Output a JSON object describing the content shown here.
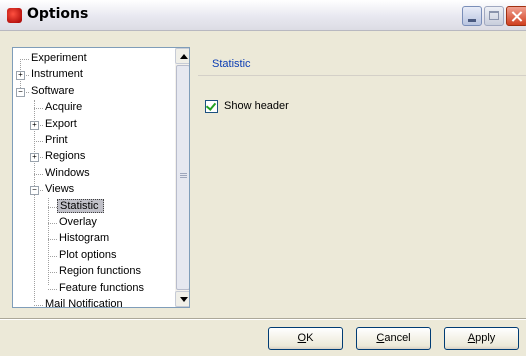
{
  "window": {
    "title": "Options"
  },
  "tree": {
    "items": [
      {
        "label": "Experiment",
        "level": 0,
        "expander": "none"
      },
      {
        "label": "Instrument",
        "level": 0,
        "expander": "+"
      },
      {
        "label": "Software",
        "level": 0,
        "expander": "-"
      },
      {
        "label": "Acquire",
        "level": 1,
        "expander": "none"
      },
      {
        "label": "Export",
        "level": 1,
        "expander": "+"
      },
      {
        "label": "Print",
        "level": 1,
        "expander": "none"
      },
      {
        "label": "Regions",
        "level": 1,
        "expander": "+"
      },
      {
        "label": "Windows",
        "level": 1,
        "expander": "none"
      },
      {
        "label": "Views",
        "level": 1,
        "expander": "-"
      },
      {
        "label": "Statistic",
        "level": 2,
        "expander": "none",
        "selected": true
      },
      {
        "label": "Overlay",
        "level": 2,
        "expander": "none"
      },
      {
        "label": "Histogram",
        "level": 2,
        "expander": "none"
      },
      {
        "label": "Plot options",
        "level": 2,
        "expander": "none"
      },
      {
        "label": "Region functions",
        "level": 2,
        "expander": "none"
      },
      {
        "label": "Feature functions",
        "level": 2,
        "expander": "none"
      },
      {
        "label": "Mail Notification",
        "level": 1,
        "expander": "none"
      }
    ]
  },
  "panel": {
    "section_title": "Statistic",
    "show_header": {
      "label": "Show header",
      "checked": true
    }
  },
  "buttons": {
    "ok": {
      "mnemonic": "O",
      "rest": "K"
    },
    "cancel": {
      "mnemonic": "C",
      "rest": "ancel"
    },
    "apply": {
      "mnemonic": "A",
      "rest": "pply"
    }
  },
  "colors": {
    "section_title": "#0a3cb4",
    "checkmark": "#21a121",
    "selection": "#c0c0c8"
  }
}
